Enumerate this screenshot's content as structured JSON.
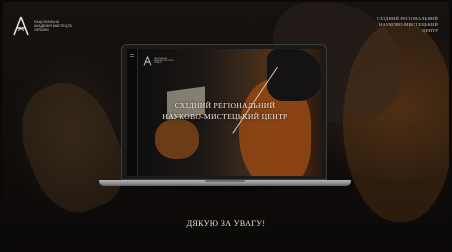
{
  "header": {
    "logo_lines": [
      "НАЦІОНАЛЬНА",
      "АКАДЕМІЯ МИСТЕЦТВ",
      "УКРАЇНИ"
    ],
    "center_name_lines": [
      "СХІДНИЙ РЕГІОНАЛЬНИЙ",
      "НАУКОВО-МИСТЕЦЬКИЙ",
      "ЦЕНТР"
    ]
  },
  "screen": {
    "logo_lines": [
      "НАЦІОНАЛЬНА",
      "АКАДЕМІЯ МИСТЕЦТВ",
      "УКРАЇНИ"
    ],
    "title_lines": [
      "СХІДНИЙ РЕГІОНАЛЬНИЙ",
      "НАУКОВО-МИСТЕЦЬКИЙ ЦЕНТР"
    ]
  },
  "footer": {
    "thanks": "ДЯКУЮ ЗА УВАГУ!"
  },
  "icons": {
    "logo": "academy-logo-icon",
    "menu": "menu-lines-icon"
  },
  "colors": {
    "background": "#100d0b",
    "text": "#eee8de",
    "accent": "#8a4a1c"
  }
}
